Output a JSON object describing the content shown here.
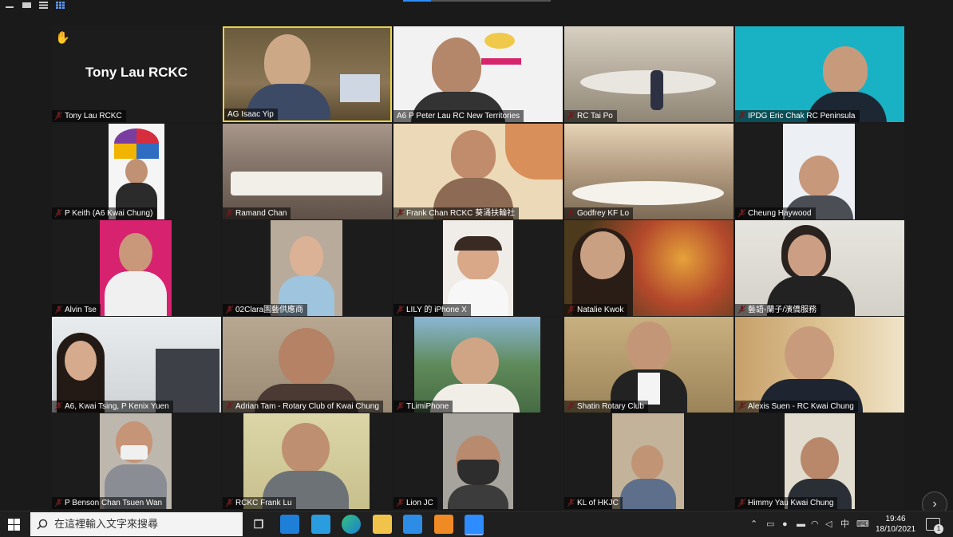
{
  "participants": [
    {
      "name": "Tony Lau RCKC",
      "display": "Tony Lau RCKC"
    },
    {
      "name": "AG Isaac Yip"
    },
    {
      "name": "A6 P Peter Lau RC New Territories"
    },
    {
      "name": "RC Tai Po"
    },
    {
      "name": "IPDG Eric Chak RC Peninsula"
    },
    {
      "name": "P Keith (A6 Kwai Chung)"
    },
    {
      "name": "Ramand Chan"
    },
    {
      "name": "Frank Chan RCKC 葵涌扶輪社"
    },
    {
      "name": "Godfrey KF Lo"
    },
    {
      "name": "Cheung Haywood"
    },
    {
      "name": "Alvin Tse"
    },
    {
      "name": "02Clara園藝供應商"
    },
    {
      "name": "LILY 的 iPhone X"
    },
    {
      "name": "Natalie Kwok"
    },
    {
      "name": "藝語-蘭子/濱僑服務"
    },
    {
      "name": "A6, Kwai Tsing, P Kenix Yuen"
    },
    {
      "name": "Adrian Tam - Rotary Club of Kwai Chung"
    },
    {
      "name": "TLimiPhone"
    },
    {
      "name": "Shatin Rotary Club"
    },
    {
      "name": "Alexis Suen - RC Kwai Chung"
    },
    {
      "name": "P Benson Chan Tsuen Wan"
    },
    {
      "name": "RCKC Frank Lu"
    },
    {
      "name": "Lion JC"
    },
    {
      "name": "KL of HKJC"
    },
    {
      "name": "Himmy Yau Kwai Chung"
    }
  ],
  "taskbar": {
    "search_placeholder": "在這裡輸入文字來搜尋",
    "ime": "中",
    "time": "19:46",
    "date": "18/10/2021",
    "notifications": "1"
  },
  "icons": {
    "raise_hand": "✋",
    "next": "›"
  },
  "colors": {
    "active_speaker": "#e8d44d",
    "muted_mic": "#e84040",
    "taskbar": "#1f1f1f"
  }
}
